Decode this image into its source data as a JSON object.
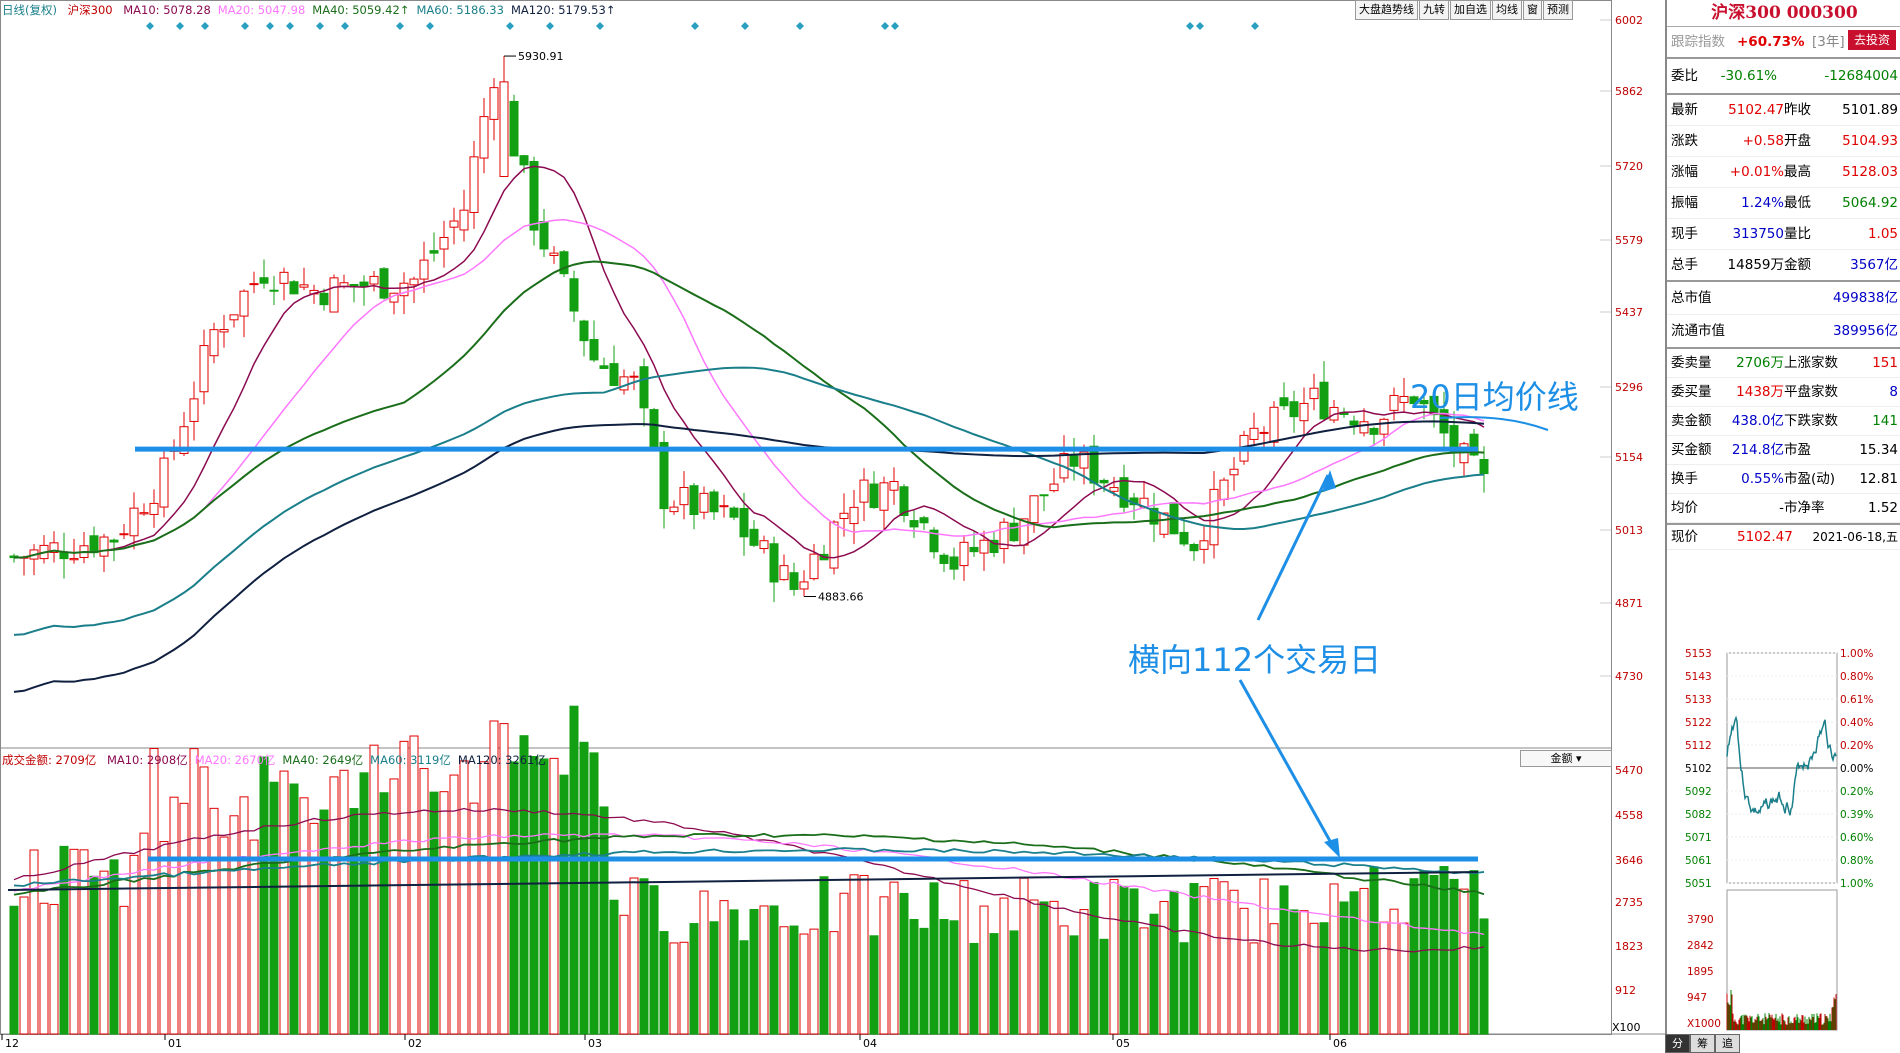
{
  "header": {
    "chart_kind": "日线(复权)",
    "index_name": "沪深300",
    "ma_labels": [
      {
        "text": "MA10: 5078.28",
        "color": "#8b0a50"
      },
      {
        "text": "MA20: 5047.98",
        "color": "#ff77ff"
      },
      {
        "text": "MA40: 5059.42↑",
        "color": "#1a6e1a"
      },
      {
        "text": "MA60: 5186.33",
        "color": "#1a7f8a"
      },
      {
        "text": "MA120: 5179.53↑",
        "color": "#102040"
      }
    ],
    "buttons": [
      "大盘趋势线",
      "九转",
      "加自选",
      "均线",
      "窗",
      "预测"
    ]
  },
  "volume_header": {
    "title": "成交金额: 2709亿",
    "ma_labels": [
      {
        "text": "MA10: 2908亿",
        "color": "#8b0a50"
      },
      {
        "text": "MA20: 2670亿",
        "color": "#ff77ff"
      },
      {
        "text": "MA40: 2649亿",
        "color": "#1a6e1a"
      },
      {
        "text": "MA60: 3119亿",
        "color": "#1a7f8a"
      },
      {
        "text": "MA120: 3261亿",
        "color": "#102040"
      }
    ],
    "selector": "金额",
    "selector_options": [
      "金额"
    ]
  },
  "annotations": {
    "ma20_label": "20日均价线",
    "horizontal_label": "横向112个交易日",
    "high_label": "5930.91",
    "low_label": "4883.66"
  },
  "colors": {
    "up": "#e00000",
    "down": "#12a012",
    "ma10": "#8b0a50",
    "ma20": "#ff77ff",
    "ma40": "#1a6e1a",
    "ma60": "#1a7f8a",
    "ma120": "#102040",
    "annotation": "#1d8fe6",
    "axis_label": "#c00000"
  },
  "chart_data": [
    {
      "type": "candlestick",
      "title": "沪深300 日线(复权)",
      "y_ticks": [
        6002,
        5862,
        5720,
        5579,
        5437,
        5296,
        5154,
        5013,
        4871,
        4730
      ],
      "ylim": [
        4600,
        6030
      ],
      "x_ticks": [
        "12",
        "01",
        "02",
        "03",
        "04",
        "05",
        "06"
      ],
      "high": 5930.91,
      "low": 4883.66,
      "reference_line": 5170,
      "series": [
        {
          "name": "MA10",
          "values": []
        },
        {
          "name": "MA20",
          "values": []
        },
        {
          "name": "MA40",
          "values": []
        },
        {
          "name": "MA60",
          "values": []
        },
        {
          "name": "MA120",
          "values": []
        }
      ]
    },
    {
      "type": "bar",
      "title": "成交金额",
      "y_ticks": [
        5470,
        4558,
        3646,
        2735,
        1823,
        912
      ],
      "y_unit_label": "X100",
      "reference_line": 3620
    }
  ],
  "panel": {
    "title": "沪深300 000300",
    "track_label": "跟踪指数",
    "track_value": "+60.73%",
    "track_years": "[3年]",
    "track_button": "去投资",
    "weibi": {
      "k": "委比",
      "v1": "-30.61%",
      "v2": "-12684004"
    },
    "rows": [
      {
        "k1": "最新",
        "v1": "5102.47",
        "c1": "red",
        "k2": "昨收",
        "v2": "5101.89",
        "c2": "black"
      },
      {
        "k1": "涨跌",
        "v1": "+0.58",
        "c1": "red",
        "k2": "开盘",
        "v2": "5104.93",
        "c2": "red"
      },
      {
        "k1": "涨幅",
        "v1": "+0.01%",
        "c1": "red",
        "k2": "最高",
        "v2": "5128.03",
        "c2": "red"
      },
      {
        "k1": "振幅",
        "v1": "1.24%",
        "c1": "blue",
        "k2": "最低",
        "v2": "5064.92",
        "c2": "green"
      },
      {
        "k1": "现手",
        "v1": "313750",
        "c1": "blue",
        "k2": "量比",
        "v2": "1.05",
        "c2": "red"
      },
      {
        "k1": "总手",
        "v1": "14859万",
        "c1": "black",
        "k2": "金额",
        "v2": "3567亿",
        "c2": "blue"
      }
    ],
    "mktcap": [
      {
        "k": "总市值",
        "v": "499838亿"
      },
      {
        "k": "流通市值",
        "v": "389956亿"
      }
    ],
    "stats": [
      {
        "k1": "委卖量",
        "v1": "2706万",
        "c1": "green",
        "k2": "上涨家数",
        "v2": "151",
        "c2": "red"
      },
      {
        "k1": "委买量",
        "v1": "1438万",
        "c1": "red",
        "k2": "平盘家数",
        "v2": "8",
        "c2": "blue"
      },
      {
        "k1": "卖金额",
        "v1": "438.0亿",
        "c1": "blue",
        "k2": "下跌家数",
        "v2": "141",
        "c2": "green"
      },
      {
        "k1": "买金额",
        "v1": "214.8亿",
        "c1": "blue",
        "k2": "市盈",
        "v2": "15.34",
        "c2": "black"
      },
      {
        "k1": "换手",
        "v1": "0.55%",
        "c1": "blue",
        "k2": "市盈(动)",
        "v2": "12.81",
        "c2": "black"
      },
      {
        "k1": "均价",
        "v1": "-",
        "c1": "black",
        "k2": "市净率",
        "v2": "1.52",
        "c2": "black"
      }
    ],
    "current_label": "现价",
    "current_value": "5102.47",
    "date": "2021-06-18,五",
    "mini_left_ticks": [
      "5153",
      "5143",
      "5133",
      "5122",
      "5112",
      "5102",
      "5092",
      "5082",
      "5071",
      "5061",
      "5051"
    ],
    "mini_right_ticks": [
      "1.00%",
      "0.80%",
      "0.61%",
      "0.40%",
      "0.20%",
      "0.00%",
      "0.20%",
      "0.39%",
      "0.60%",
      "0.80%",
      "1.00%"
    ],
    "mini_vol_ticks": [
      "3790",
      "2842",
      "1895",
      "947",
      "X1000"
    ],
    "tabs": [
      "分",
      "筹",
      "追"
    ]
  }
}
